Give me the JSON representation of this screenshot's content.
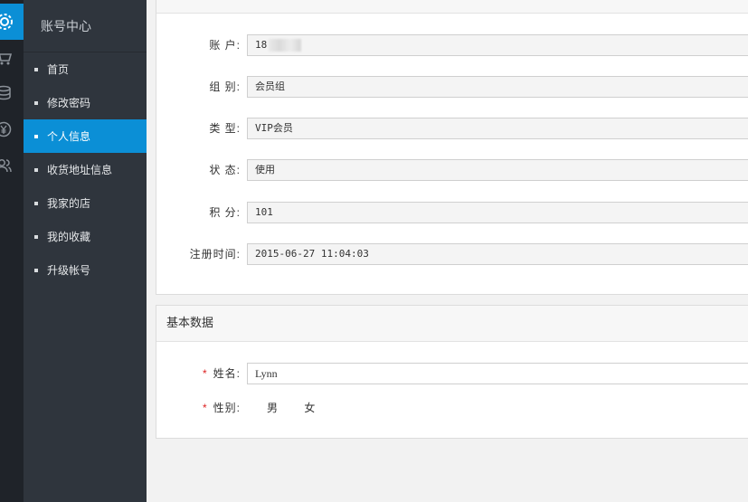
{
  "sidebar": {
    "title": "账号中心",
    "items": [
      {
        "label": "首页"
      },
      {
        "label": "修改密码"
      },
      {
        "label": "个人信息"
      },
      {
        "label": "收货地址信息"
      },
      {
        "label": "我家的店"
      },
      {
        "label": "我的收藏"
      },
      {
        "label": "升级帐号"
      }
    ]
  },
  "rail": {
    "icons": [
      "gear-icon",
      "cart-icon",
      "coins-icon",
      "yen-icon",
      "users-icon"
    ]
  },
  "account": {
    "account_label": "账 户:",
    "account_value": "18",
    "group_label": "组 别:",
    "group_value": "会员组",
    "type_label": "类 型:",
    "type_value": "VIP会员",
    "status_label": "状 态:",
    "status_value": "使用",
    "points_label": "积 分:",
    "points_value": "101",
    "regtime_label": "注册时间:",
    "regtime_value": "2015-06-27 11:04:03"
  },
  "basic": {
    "title": "基本数据",
    "name_label": "姓名:",
    "name_value": "Lynn",
    "gender_label": "性别:",
    "gender_male": "男",
    "gender_female": "女"
  },
  "colors": {
    "accent": "#0b8fd6",
    "menu_bg": "#2f353d",
    "rail_bg": "#1f2329"
  }
}
